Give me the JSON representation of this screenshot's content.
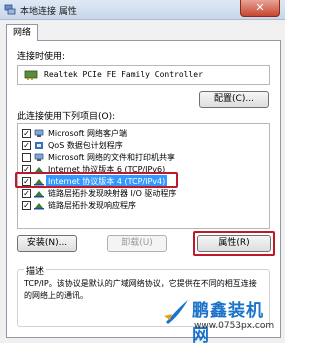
{
  "window": {
    "title": "本地连接 属性",
    "close_glyph": "✕"
  },
  "tabs": [
    {
      "label": "网络"
    }
  ],
  "connect_using": {
    "label": "连接时使用:",
    "adapter_name": "Realtek PCIe FE Family Controller",
    "configure_button": "配置(C)..."
  },
  "items_section": {
    "label": "此连接使用下列项目(O):",
    "items": [
      {
        "label": "Microsoft 网络客户端",
        "checked": true,
        "icon": "network-client-icon"
      },
      {
        "label": "QoS 数据包计划程序",
        "checked": true,
        "icon": "qos-icon"
      },
      {
        "label": "Microsoft 网络的文件和打印机共享",
        "checked": false,
        "icon": "file-sharing-icon"
      },
      {
        "label": "Internet 协议版本 6 (TCP/IPv6)",
        "checked": true,
        "icon": "protocol-icon"
      },
      {
        "label": "Internet 协议版本 4 (TCP/IPv4)",
        "checked": true,
        "icon": "protocol-icon",
        "selected": true
      },
      {
        "label": "链路层拓扑发现映射器 I/O 驱动程序",
        "checked": true,
        "icon": "protocol-icon"
      },
      {
        "label": "链路层拓扑发现响应程序",
        "checked": true,
        "icon": "protocol-icon"
      }
    ]
  },
  "buttons": {
    "install": "安装(N)...",
    "uninstall": "卸载(U)",
    "properties": "属性(R)"
  },
  "description": {
    "title": "描述",
    "text": "TCP/IP。该协议是默认的广域网络协议，它提供在不同的相互连接的网络上的通讯。"
  },
  "watermark": {
    "brand": "鹏鑫装机网",
    "url": "www.0753px.com"
  },
  "colors": {
    "selection": "#3399ff",
    "highlight_box": "#c0182a",
    "watermark_blue": "#1a73c9"
  }
}
